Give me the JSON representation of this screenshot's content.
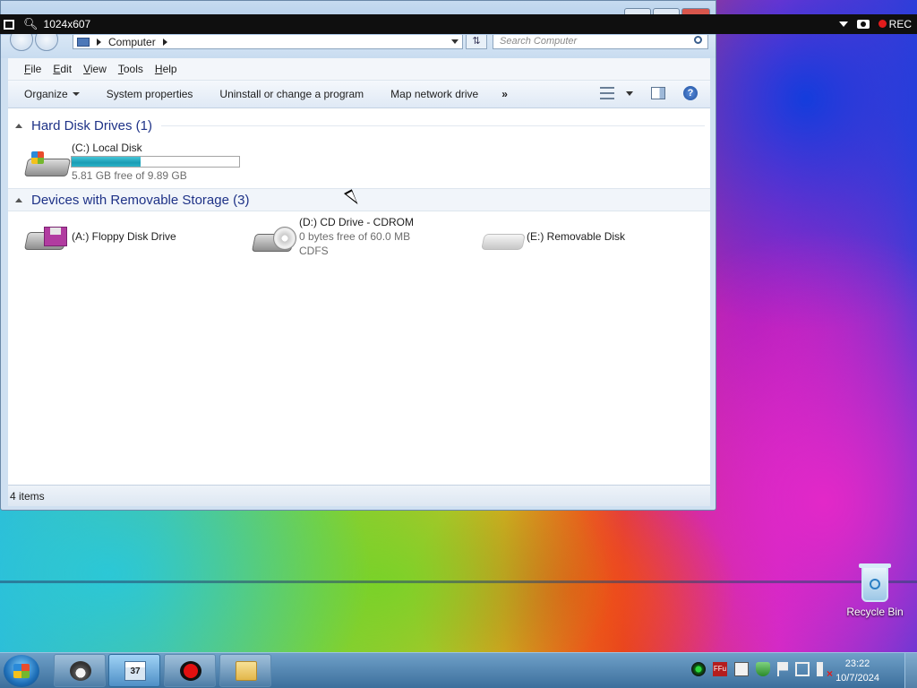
{
  "overlay": {
    "size_label": "1024x607",
    "rec_label": "REC"
  },
  "window": {
    "address": {
      "location": "Computer"
    },
    "search_placeholder": "Search Computer",
    "menu": [
      "File",
      "Edit",
      "View",
      "Tools",
      "Help"
    ],
    "toolbar": {
      "organize": "Organize",
      "system_properties": "System properties",
      "uninstall": "Uninstall or change a program",
      "map_drive": "Map network drive",
      "more": "»"
    },
    "groups": {
      "hdd_title": "Hard Disk Drives (1)",
      "removable_title": "Devices with Removable Storage (3)"
    },
    "drives": {
      "c": {
        "name": "(C:) Local Disk",
        "free_text": "5.81 GB free of 9.89 GB",
        "used_fraction": 0.41
      },
      "a": {
        "name": "(A:) Floppy Disk Drive"
      },
      "d": {
        "name": "(D:) CD Drive - CDROM",
        "free_text": "0 bytes free of 60.0 MB",
        "fs": "CDFS"
      },
      "e": {
        "name": "(E:) Removable Disk"
      }
    },
    "status": "4 items"
  },
  "desktop": {
    "recycle_bin": "Recycle Bin"
  },
  "taskbar": {
    "calendar_day": "37",
    "tray_ffu": "FFu",
    "clock_time": "23:22",
    "clock_date": "10/7/2024"
  }
}
